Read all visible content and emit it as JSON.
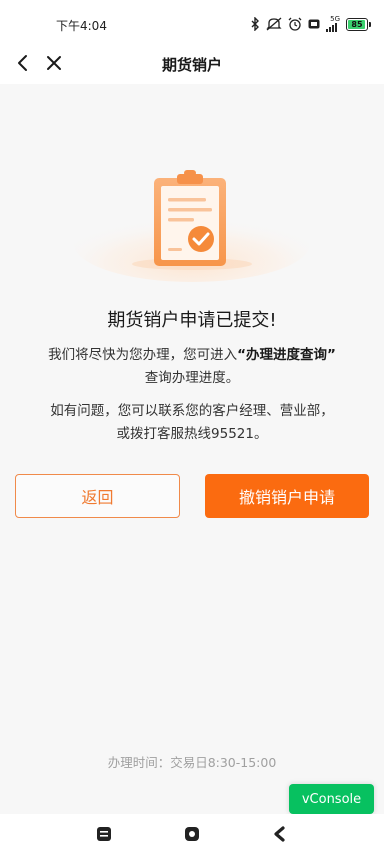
{
  "status_bar": {
    "time": "下午4:04",
    "network": "5G",
    "battery": "85",
    "icons": [
      "bluetooth-icon",
      "mute-icon",
      "alarm-icon",
      "hd-icon",
      "signal-icon",
      "battery-icon"
    ]
  },
  "nav": {
    "title": "期货销户",
    "back_icon": "chevron-left-icon",
    "close_icon": "close-icon"
  },
  "result": {
    "illustration": "clipboard-check-icon",
    "title": "期货销户申请已提交!",
    "desc1_pre": "我们将尽快为您办理，您可进入",
    "desc1_link": "“办理进度查询”",
    "desc1_post": "查询办理进度。",
    "desc2_line1": "如有问题，您可以联系您的客户经理、营业部，",
    "desc2_line2": "或拨打客服热线95521。"
  },
  "buttons": {
    "return_label": "返回",
    "cancel_label": "撤销销户申请"
  },
  "footer": {
    "hours": "办理时间：交易日8:30-15:00"
  },
  "vconsole": {
    "label": "vConsole"
  },
  "colors": {
    "accent": "#fb6b10",
    "accent_text": "#f07a30",
    "vconsole": "#07c160",
    "background": "#f7f7f7"
  }
}
